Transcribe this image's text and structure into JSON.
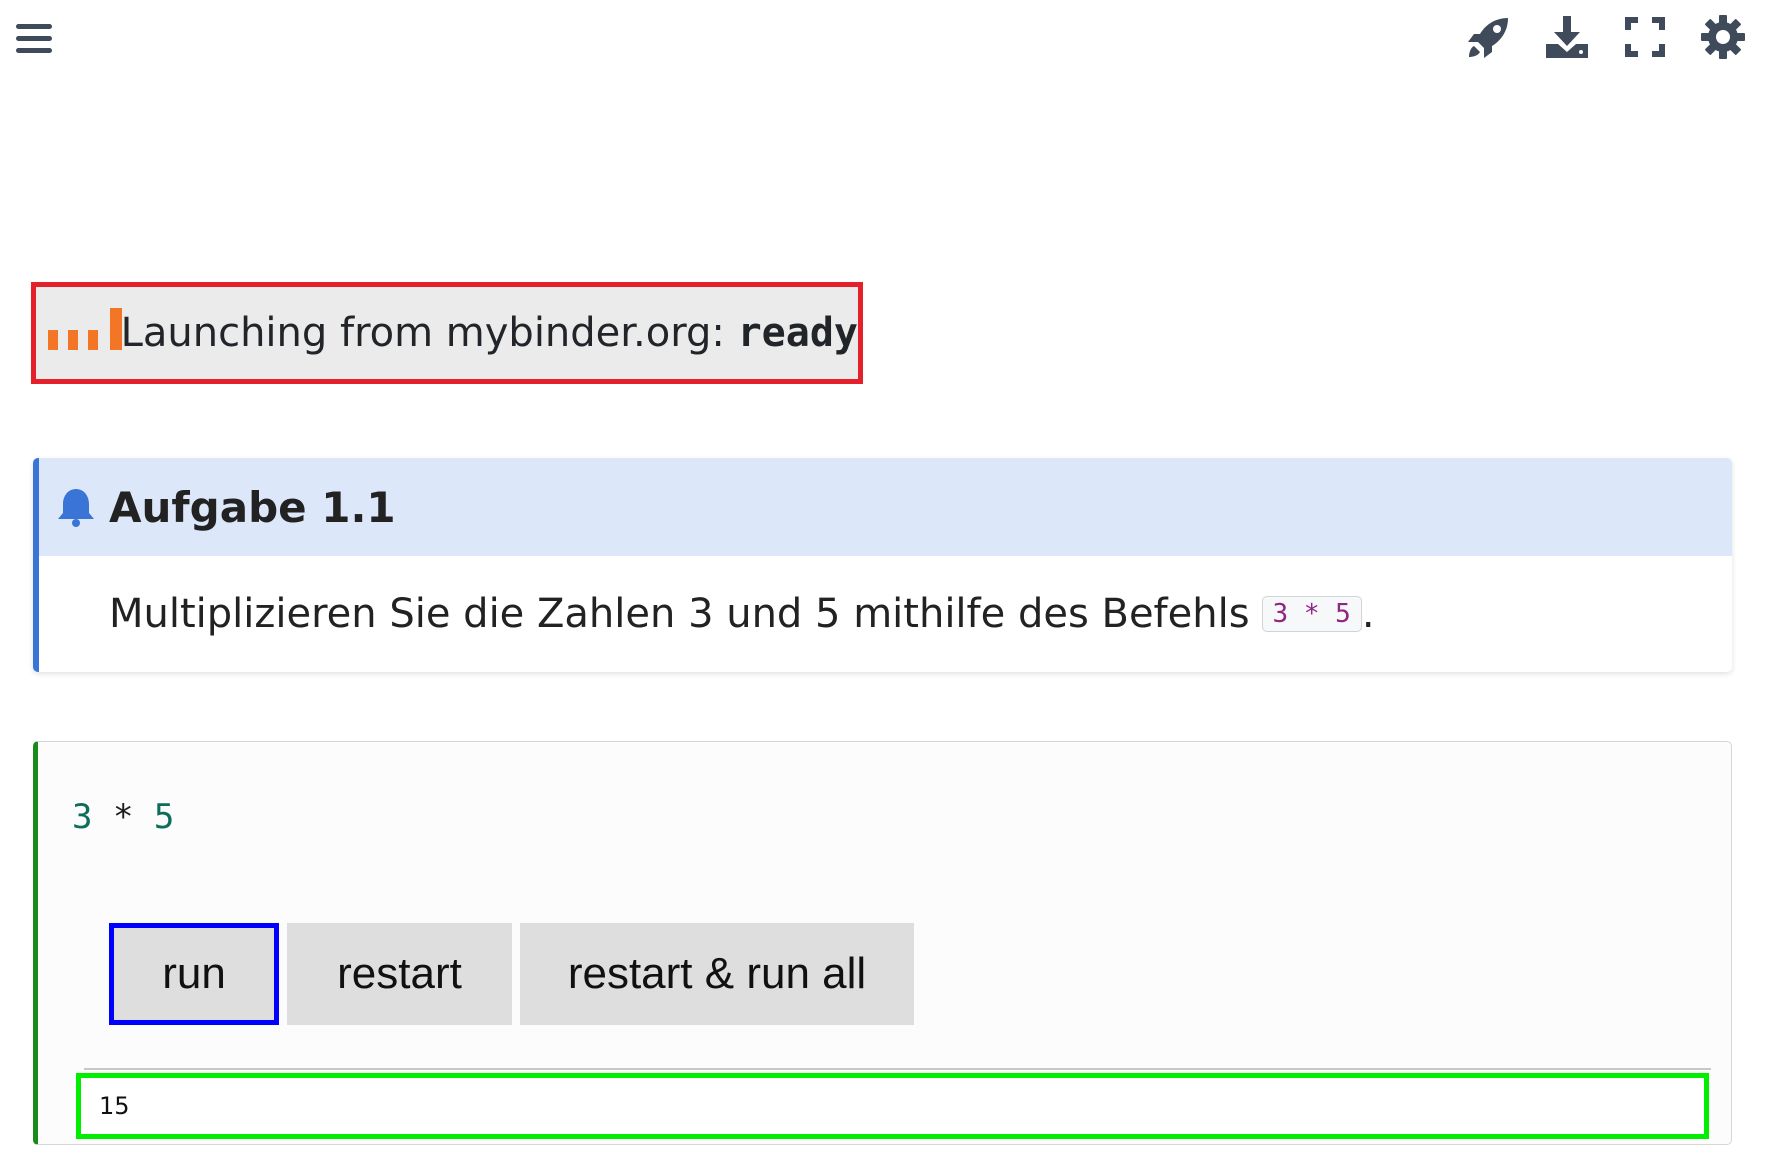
{
  "toolbar": {
    "icons": [
      "menu-icon",
      "rocket-icon",
      "download-icon",
      "fullscreen-icon",
      "gear-icon"
    ],
    "icon_color": "#3f4a5a"
  },
  "launch": {
    "text": "Launching from mybinder.org: ",
    "status": "ready",
    "border_color": "#e4202b",
    "accent_color": "#f37626"
  },
  "admonition": {
    "title": "Aufgabe 1.1",
    "body": "Multiplizieren Sie die Zahlen 3 und 5 mithilfe des Befehls",
    "code": "3 * 5",
    "trailing": ".",
    "accent_color": "#3a74d7"
  },
  "cell": {
    "code_a": "3",
    "code_op": " * ",
    "code_b": "5",
    "buttons": {
      "run": "run",
      "restart": "restart",
      "restart_all": "restart & run all"
    },
    "output": "15",
    "run_highlight_color": "#0000ff",
    "output_highlight_color": "#00ee00"
  }
}
